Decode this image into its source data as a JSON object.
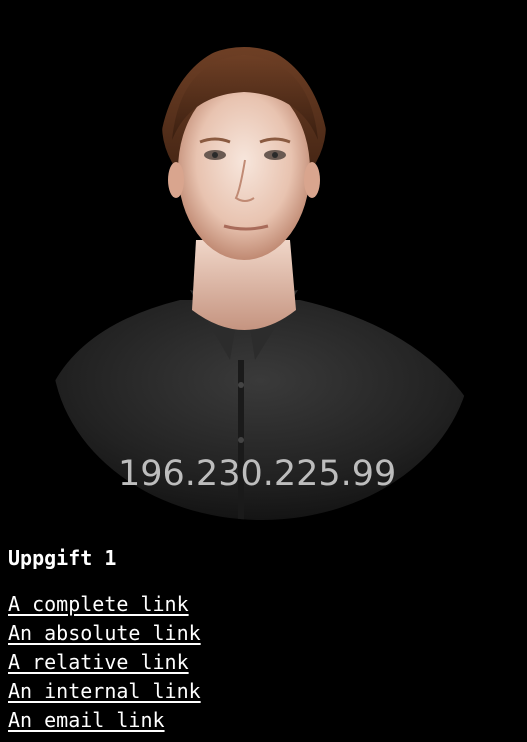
{
  "hero": {
    "image": "portrait-photo",
    "ip_address": "196.230.225.99"
  },
  "section": {
    "title": "Uppgift 1"
  },
  "links": [
    {
      "label": "A complete link"
    },
    {
      "label": "An absolute link"
    },
    {
      "label": "A relative link"
    },
    {
      "label": "An internal link"
    },
    {
      "label": "An email link"
    }
  ],
  "colors": {
    "background": "#000000",
    "text": "#ffffff",
    "overlay_text": "#bdbdbd"
  }
}
